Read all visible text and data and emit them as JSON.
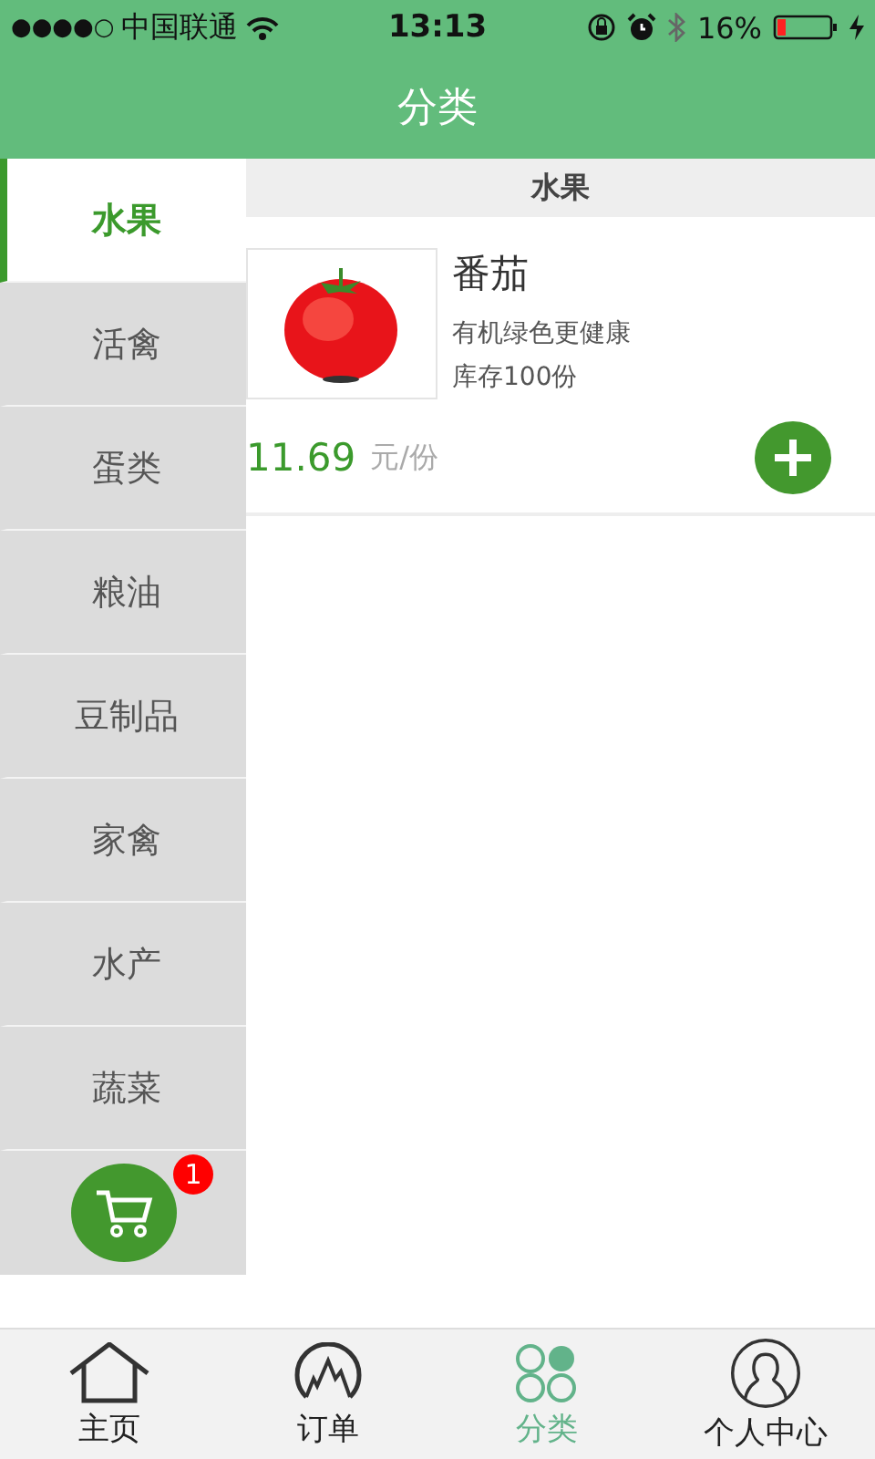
{
  "status_bar": {
    "signal": "●●●●○",
    "carrier": "中国联通",
    "time": "13:13",
    "battery_text": "16%",
    "battery": {
      "level": 0.16
    }
  },
  "header": {
    "title": "分类"
  },
  "categories": [
    {
      "label": "水果",
      "selected": true
    },
    {
      "label": "活禽",
      "selected": false
    },
    {
      "label": "蛋类",
      "selected": false
    },
    {
      "label": "粮油",
      "selected": false
    },
    {
      "label": "豆制品",
      "selected": false
    },
    {
      "label": "家禽",
      "selected": false
    },
    {
      "label": "水产",
      "selected": false
    },
    {
      "label": "蔬菜",
      "selected": false
    }
  ],
  "cart": {
    "badge": "1"
  },
  "section_title": "水果",
  "products": [
    {
      "name": "番茄",
      "description": "有机绿色更健康",
      "stock": "库存100份",
      "price": "11.69",
      "unit": "元/份"
    }
  ],
  "tab_bar": [
    {
      "label": "主页",
      "kind": "home",
      "selected": false
    },
    {
      "label": "订单",
      "kind": "orders",
      "selected": false
    },
    {
      "label": "分类",
      "kind": "category",
      "selected": true
    },
    {
      "label": "个人中心",
      "kind": "profile",
      "selected": false
    }
  ]
}
